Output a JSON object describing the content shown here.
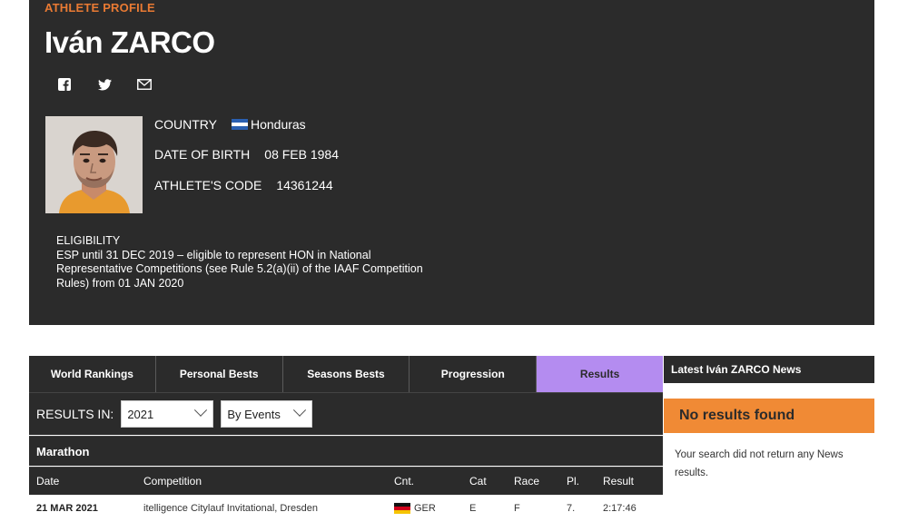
{
  "profile": {
    "kicker": "ATHLETE PROFILE",
    "name": "Iván ZARCO",
    "country_label": "COUNTRY",
    "country_value": "Honduras",
    "dob_label": "DATE OF BIRTH",
    "dob_value": "08 FEB 1984",
    "code_label": "ATHLETE'S CODE",
    "code_value": "14361244",
    "eligibility_title": "ELIGIBILITY",
    "eligibility_text": "ESP until 31 DEC 2019 – eligible to represent HON in National Representative Competitions (see Rule 5.2(a)(ii) of the IAAF Competition Rules) from 01 JAN 2020"
  },
  "social": {
    "icons": [
      "facebook-icon",
      "twitter-icon",
      "mail-icon"
    ]
  },
  "tabs": [
    {
      "label": "World Rankings"
    },
    {
      "label": "Personal Bests"
    },
    {
      "label": "Seasons Bests"
    },
    {
      "label": "Progression"
    },
    {
      "label": "Results",
      "active": true
    }
  ],
  "filters": {
    "label": "RESULTS IN:",
    "year": "2021",
    "mode": "By Events"
  },
  "event": {
    "name": "Marathon"
  },
  "table": {
    "headers": [
      "Date",
      "Competition",
      "Cnt.",
      "Cat",
      "Race",
      "Pl.",
      "Result"
    ],
    "rows": [
      {
        "date": "21 MAR 2021",
        "competition": "itelligence Citylauf Invitational, Dresden",
        "country": "GER",
        "cat": "E",
        "race": "F",
        "place": "7.",
        "result": "2:17:46"
      }
    ]
  },
  "news": {
    "title": "Latest Iván ZARCO News",
    "empty_title": "No results found",
    "empty_text": "Your search did not return any News results."
  },
  "colors": {
    "panel": "#2b2b2b",
    "accent_orange": "#e97a33",
    "active_tab": "#b48cf0",
    "no_results": "#f08a35"
  }
}
